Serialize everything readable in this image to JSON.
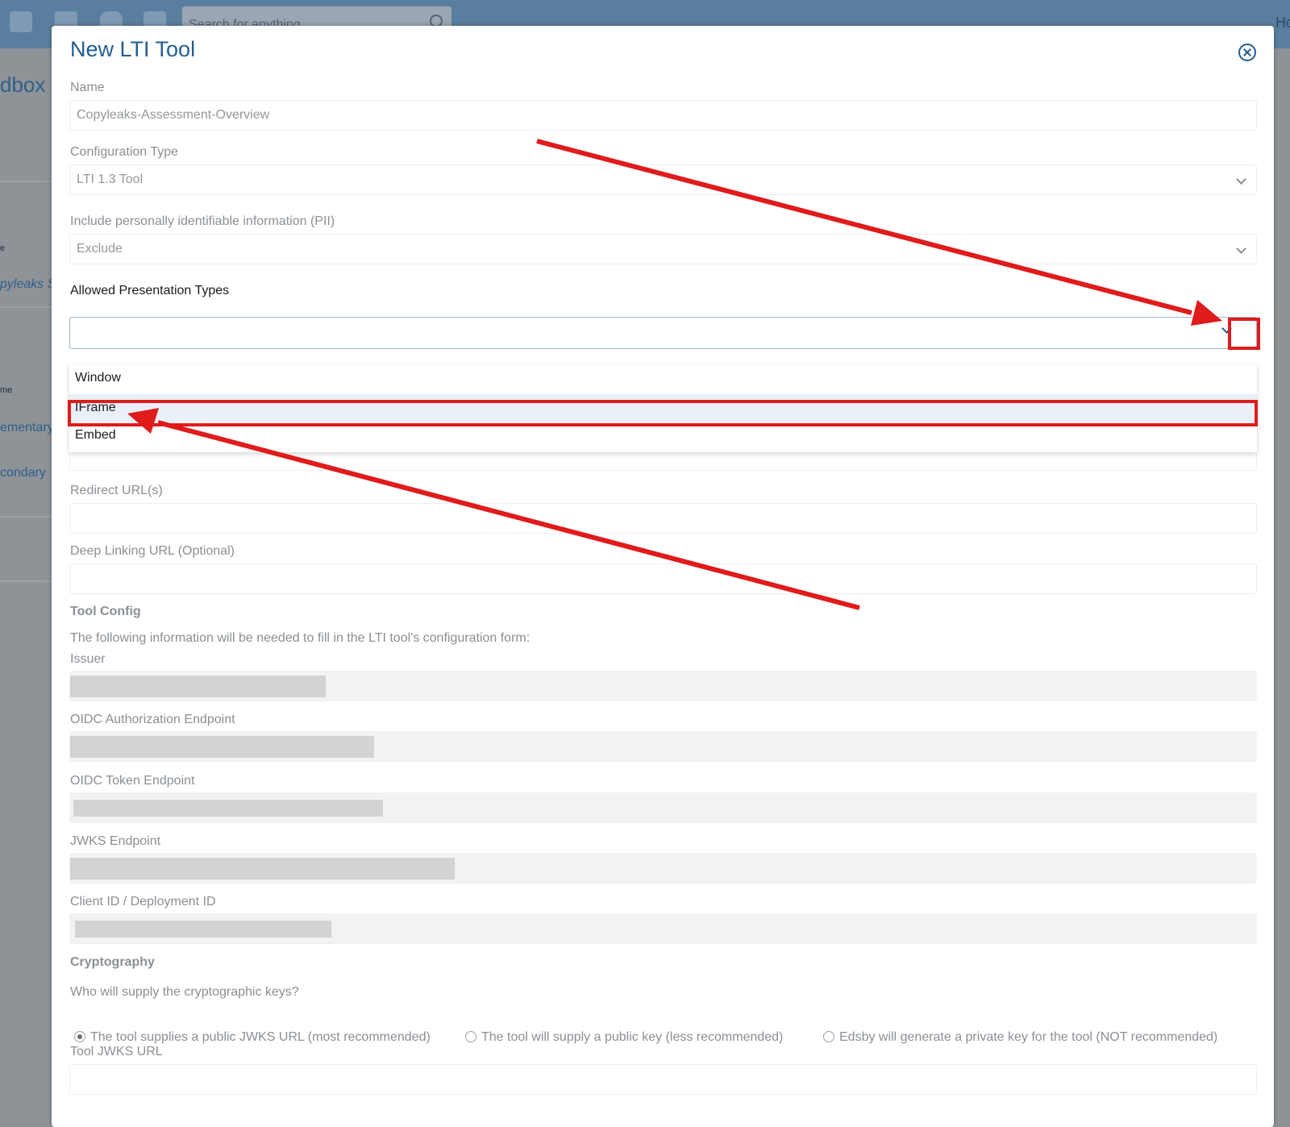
{
  "background": {
    "search_placeholder": "Search for anything",
    "corner_text": "Ho",
    "left_texts": [
      "dbox",
      "pyleaks S",
      "ementary",
      "condary"
    ],
    "left_small": [
      "e",
      "me"
    ]
  },
  "modal": {
    "title": "New LTI Tool",
    "name": {
      "label": "Name",
      "value": "Copyleaks-Assessment-Overview"
    },
    "config_type": {
      "label": "Configuration Type",
      "value": "LTI 1.3 Tool"
    },
    "pii": {
      "label": "Include personally identifiable information (PII)",
      "value": "Exclude"
    },
    "presentation": {
      "label": "Allowed Presentation Types",
      "options": [
        "Window",
        "IFrame",
        "Embed"
      ],
      "highlighted": "IFrame"
    },
    "redirect": {
      "label": "Redirect URL(s)"
    },
    "deep_linking": {
      "label": "Deep Linking URL (Optional)"
    },
    "tool_config": {
      "heading": "Tool Config",
      "description": "The following information will be needed to fill in the LTI tool's configuration form:",
      "issuer": "Issuer",
      "oidc_auth": "OIDC Authorization Endpoint",
      "oidc_token": "OIDC Token Endpoint",
      "jwks": "JWKS Endpoint",
      "client_id": "Client ID / Deployment ID"
    },
    "cryptography": {
      "heading": "Cryptography",
      "question": "Who will supply the cryptographic keys?",
      "options": [
        "The tool supplies a public JWKS URL (most recommended)",
        "The tool will supply a public key (less recommended)",
        "Edsby will generate a private key for the tool (NOT recommended)"
      ],
      "selected_index": 0,
      "tool_jwks_label": "Tool JWKS URL"
    }
  },
  "annotation_color": "#e01b1b"
}
